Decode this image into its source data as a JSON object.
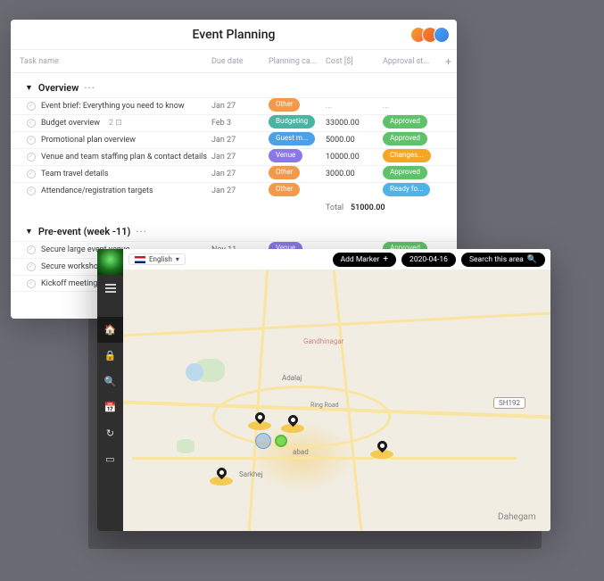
{
  "planner": {
    "title": "Event Planning",
    "columns": {
      "task": "Task name",
      "due": "Due date",
      "planning": "Planning ca...",
      "cost": "Cost [$]",
      "approval": "Approval st...",
      "add": "+"
    },
    "sections": {
      "overview": {
        "label": "Overview",
        "dots": "···"
      },
      "preevent": {
        "label": "Pre-event (week -11)",
        "dots": "···"
      }
    },
    "rows": {
      "r1": {
        "task": "Event brief: Everything you need to know",
        "due": "Jan 27",
        "plan": "Other",
        "cost": "...",
        "appr": "..."
      },
      "r2": {
        "task": "Budget overview",
        "sub": "2 ⊡",
        "due": "Feb 3",
        "plan": "Budgeting",
        "cost": "33000.00",
        "appr": "Approved"
      },
      "r3": {
        "task": "Promotional plan overview",
        "due": "Jan 27",
        "plan": "Guest m...",
        "cost": "5000.00",
        "appr": "Approved"
      },
      "r4": {
        "task": "Venue and team staffing plan & contact details",
        "due": "Jan 27",
        "plan": "Venue",
        "cost": "10000.00",
        "appr": "Changes..."
      },
      "r5": {
        "task": "Team travel details",
        "due": "Jan 27",
        "plan": "Other",
        "cost": "3000.00",
        "appr": "Approved"
      },
      "r6": {
        "task": "Attendance/registration targets",
        "due": "Jan 27",
        "plan": "Other",
        "cost": "",
        "appr": "Ready fo..."
      },
      "total": {
        "label": "Total",
        "value": "51000.00"
      },
      "p1": {
        "task": "Secure large event venue",
        "due": "Nov 11",
        "plan": "Venue",
        "cost": "...",
        "appr": "Approved"
      },
      "p2": {
        "task": "Secure workshop venue"
      },
      "p3": {
        "task": "Kickoff meeting with sta"
      }
    }
  },
  "map": {
    "nav": {
      "home_tooltip": "Home"
    },
    "lang": {
      "label": "English",
      "caret": "▾"
    },
    "buttons": {
      "add_marker": "Add Marker",
      "date": "2020-04-16",
      "search": "Search this area"
    },
    "labels": {
      "dahegam": "Dahegam",
      "gandhinagar": "Gandhinagar",
      "adalaj": "Adalaj",
      "abad": "abad",
      "sarkhej": "Sarkhej",
      "shield": "SH192",
      "ringroad": "Ring Road"
    }
  }
}
